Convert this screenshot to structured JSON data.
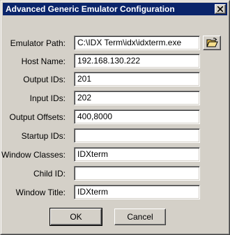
{
  "window": {
    "title": "Advanced Generic Emulator Configuration"
  },
  "titlebar_icons": {
    "close": "close-icon"
  },
  "fields": [
    {
      "label": "Emulator Path:",
      "value": "C:\\IDX Term\\idx\\idxterm.exe"
    },
    {
      "label": "Host Name:",
      "value": "192.168.130.222"
    },
    {
      "label": "Output IDs:",
      "value": "201"
    },
    {
      "label": "Input IDs:",
      "value": "202"
    },
    {
      "label": "Output Offsets:",
      "value": "400,8000"
    },
    {
      "label": "Startup IDs:",
      "value": ""
    },
    {
      "label": "Window Classes:",
      "value": "IDXterm"
    },
    {
      "label": "Child ID:",
      "value": ""
    },
    {
      "label": "Window Title:",
      "value": "IDXterm"
    }
  ],
  "browse_button": {
    "icon": "open-folder-icon"
  },
  "buttons": {
    "ok_label": "OK",
    "cancel_label": "Cancel"
  },
  "colors": {
    "titlebar": "#0a246a",
    "face": "#d4d0c8",
    "field_bg": "#ffffff"
  }
}
